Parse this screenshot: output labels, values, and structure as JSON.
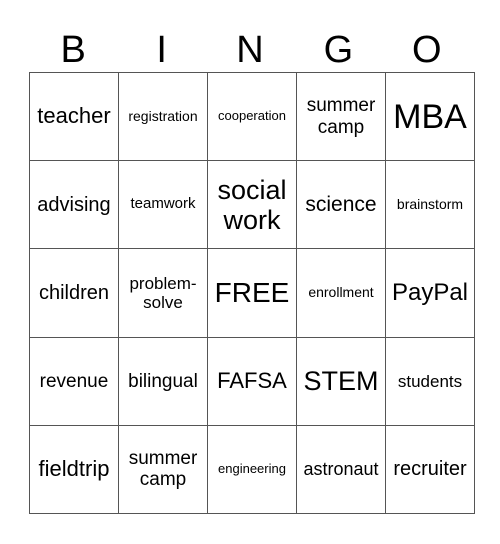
{
  "header": [
    "B",
    "I",
    "N",
    "G",
    "O"
  ],
  "rows": [
    [
      {
        "t": "teacher",
        "s": 22
      },
      {
        "t": "registration",
        "s": 14
      },
      {
        "t": "cooperation",
        "s": 13
      },
      {
        "t": "summer camp",
        "s": 19
      },
      {
        "t": "MBA",
        "s": 34
      }
    ],
    [
      {
        "t": "advising",
        "s": 20
      },
      {
        "t": "teamwork",
        "s": 15
      },
      {
        "t": "social work",
        "s": 27
      },
      {
        "t": "science",
        "s": 21
      },
      {
        "t": "brainstorm",
        "s": 14
      }
    ],
    [
      {
        "t": "children",
        "s": 20
      },
      {
        "t": "problem-solve",
        "s": 17
      },
      {
        "t": "FREE",
        "s": 28
      },
      {
        "t": "enrollment",
        "s": 14
      },
      {
        "t": "PayPal",
        "s": 24
      }
    ],
    [
      {
        "t": "revenue",
        "s": 19
      },
      {
        "t": "bilingual",
        "s": 19
      },
      {
        "t": "FAFSA",
        "s": 22
      },
      {
        "t": "STEM",
        "s": 27
      },
      {
        "t": "students",
        "s": 17
      }
    ],
    [
      {
        "t": "fieldtrip",
        "s": 22
      },
      {
        "t": "summer camp",
        "s": 19
      },
      {
        "t": "engineering",
        "s": 13
      },
      {
        "t": "astronaut",
        "s": 18
      },
      {
        "t": "recruiter",
        "s": 20
      }
    ]
  ]
}
